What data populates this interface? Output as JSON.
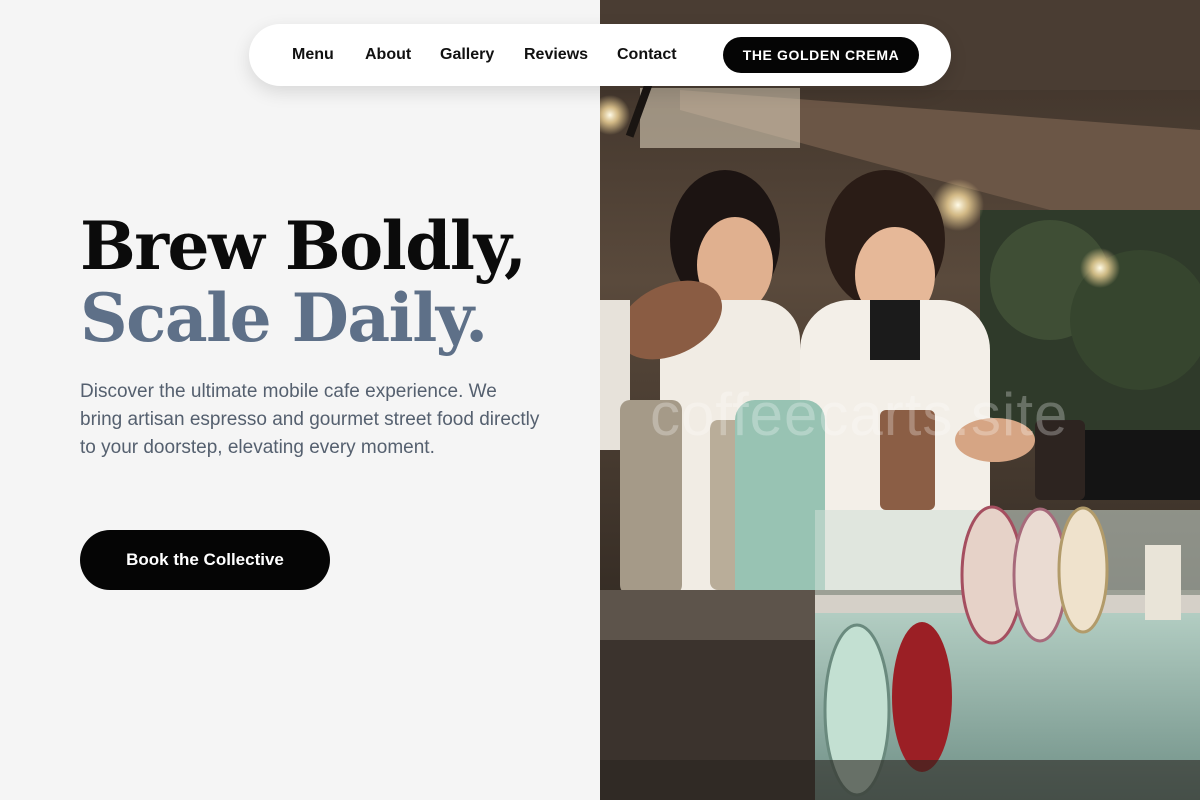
{
  "nav": {
    "links": [
      "Menu",
      "About",
      "Gallery",
      "Reviews",
      "Contact"
    ],
    "brand": "THE GOLDEN CREMA"
  },
  "hero": {
    "headline_line1": "Brew Boldly,",
    "headline_line2": "Scale Daily.",
    "description": "Discover the ultimate mobile cafe experience. We bring artisan espresso and gourmet street food directly to your doorstep, elevating every moment.",
    "cta_label": "Book the Collective"
  },
  "photo": {
    "watermark": "coffeecarts.site"
  },
  "colors": {
    "accent_headline": "#5e7088",
    "button_bg": "#050505",
    "page_bg": "#f5f5f5"
  }
}
